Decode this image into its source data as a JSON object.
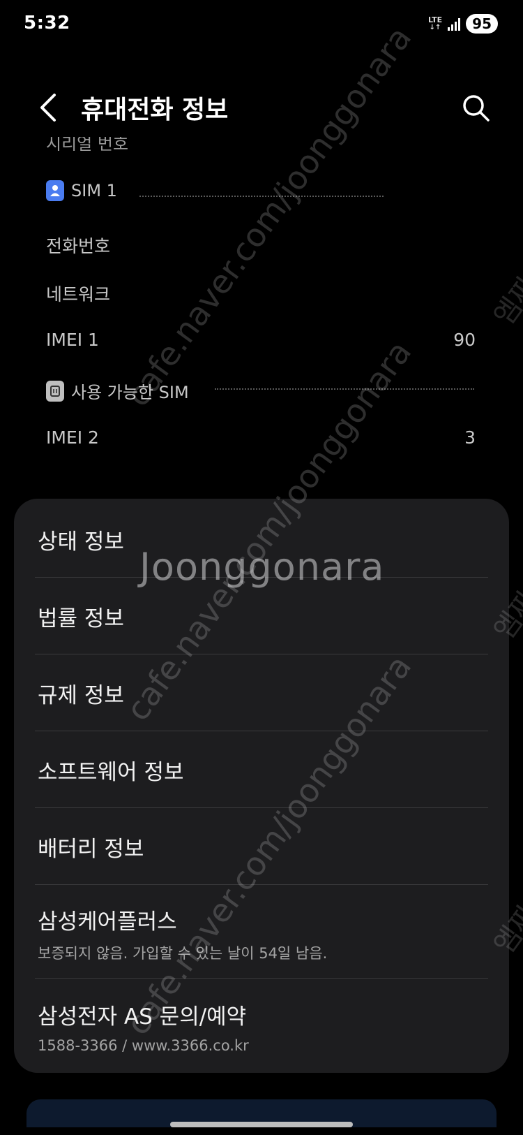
{
  "status_bar": {
    "time": "5:32",
    "network": "LTE",
    "network_arrows": "↓↑",
    "battery": "95"
  },
  "header": {
    "title": "휴대전화 정보",
    "back_icon": "chevron-left-icon",
    "search_icon": "search-icon"
  },
  "clipped_row": {
    "label": "시리얼 번호"
  },
  "sim1": {
    "section_label": "SIM 1",
    "rows": [
      {
        "label": "전화번호",
        "value": ""
      },
      {
        "label": "네트워크",
        "value": ""
      },
      {
        "label": "IMEI 1",
        "value": "90"
      }
    ]
  },
  "available_sim": {
    "section_label": "사용 가능한 SIM",
    "rows": [
      {
        "label": "IMEI 2",
        "value": "3"
      }
    ]
  },
  "menu": {
    "items": [
      {
        "title": "상태 정보",
        "subtitle": ""
      },
      {
        "title": "법률 정보",
        "subtitle": ""
      },
      {
        "title": "규제 정보",
        "subtitle": ""
      },
      {
        "title": "소프트웨어 정보",
        "subtitle": ""
      },
      {
        "title": "배터리 정보",
        "subtitle": ""
      },
      {
        "title": "삼성케어플러스",
        "subtitle": "보증되지 않음. 가입할 수 있는 날이 54일 남음."
      },
      {
        "title": "삼성전자 AS 문의/예약",
        "subtitle": "1588-3366 / www.3366.co.kr"
      }
    ]
  },
  "watermark": {
    "brand": "Joonggonara",
    "url": "cafe.naver.com/joonggonara",
    "side": "엠짜"
  }
}
